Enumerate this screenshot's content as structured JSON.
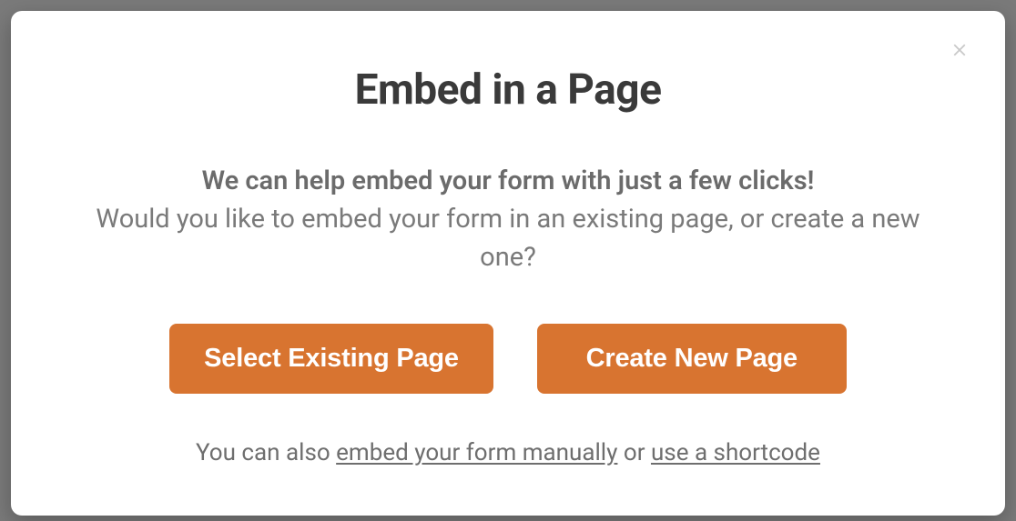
{
  "modal": {
    "title": "Embed in a Page",
    "intro_strong": "We can help embed your form with just a few clicks!",
    "intro_sub": "Would you like to embed your form in an existing page, or create a new one?",
    "buttons": {
      "select_existing": "Select Existing Page",
      "create_new": "Create New Page"
    },
    "footer": {
      "prefix": "You can also ",
      "link_manual": "embed your form manually",
      "or": " or ",
      "link_shortcode": "use a shortcode"
    }
  },
  "colors": {
    "accent": "#d87430",
    "text_dark": "#3a3a3a",
    "text_muted": "#6e6e6e"
  }
}
